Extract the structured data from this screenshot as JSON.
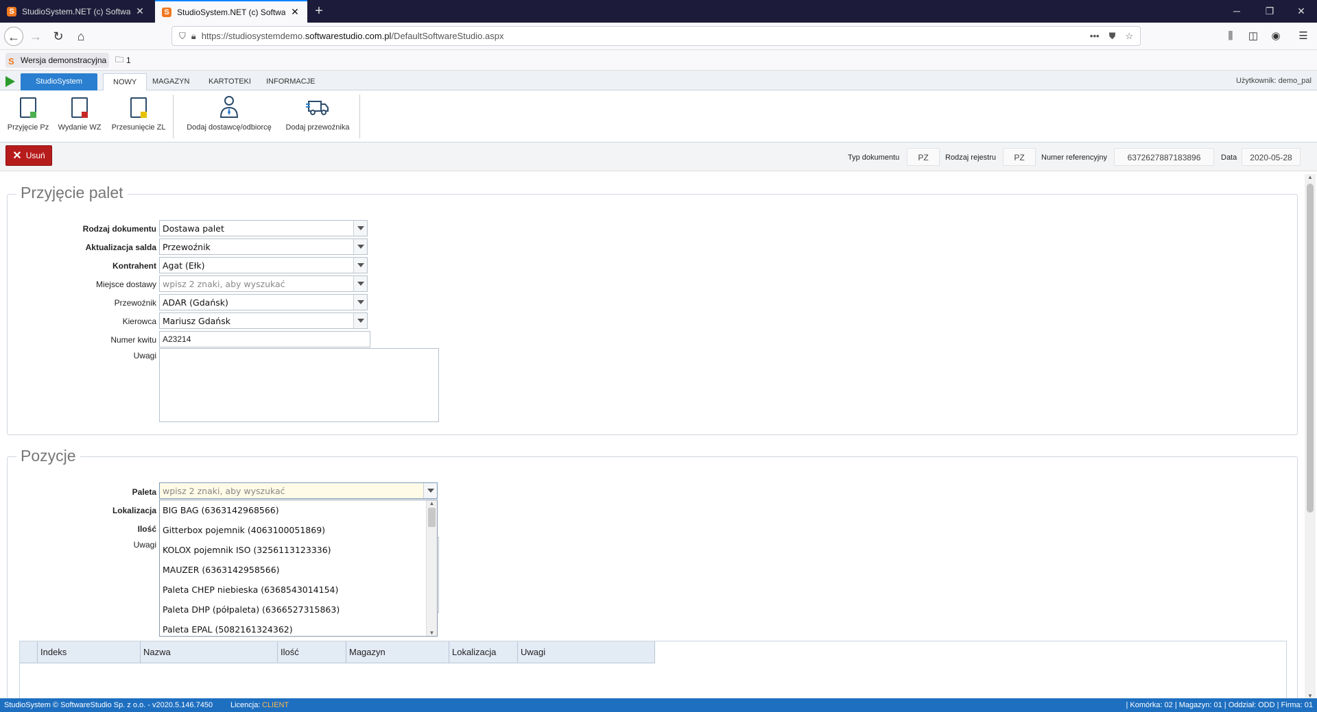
{
  "browser": {
    "tabs": [
      {
        "title": "StudioSystem.NET (c) Software",
        "active": false
      },
      {
        "title": "StudioSystem.NET (c) Software",
        "active": true
      }
    ],
    "url_prefix": "https://studiosystemdemo.",
    "url_domain": "softwarestudio.com.pl",
    "url_path": "/DefaultSoftwareStudio.aspx",
    "bookmarks": [
      {
        "label": "Wersja demonstracyjna"
      },
      {
        "label": "1"
      }
    ]
  },
  "app": {
    "app_tab": "StudioSystem",
    "tabs": [
      "NOWY",
      "MAGAZYN",
      "KARTOTEKI",
      "INFORMACJE"
    ],
    "user_label": "Użytkownik: demo_pal",
    "ribbon": [
      {
        "label": "Przyjęcie Pz"
      },
      {
        "label": "Wydanie WZ"
      },
      {
        "label": "Przesunięcie ZL"
      },
      {
        "label": "Dodaj dostawcę/odbiorcę"
      },
      {
        "label": "Dodaj przewoźnika"
      }
    ]
  },
  "toolbar": {
    "delete_label": "Usuń",
    "doc_type_label": "Typ dokumentu",
    "doc_type_value": "PZ",
    "register_label": "Rodzaj rejestru",
    "register_value": "PZ",
    "ref_label": "Numer referencyjny",
    "ref_value": "6372627887183896",
    "date_label": "Data",
    "date_value": "2020-05-28"
  },
  "header_form": {
    "legend": "Przyjęcie palet",
    "fields": [
      {
        "label": "Rodzaj dokumentu",
        "value": "Dostawa palet"
      },
      {
        "label": "Aktualizacja salda",
        "value": "Przewoźnik"
      },
      {
        "label": "Kontrahent",
        "value": "Agat (Ełk)"
      },
      {
        "label": "Miejsce dostawy",
        "placeholder": "wpisz 2 znaki, aby wyszukać"
      },
      {
        "label": "Przewoźnik",
        "value": "ADAR (Gdańsk)"
      },
      {
        "label": "Kierowca",
        "value": "Mariusz Gdańsk"
      }
    ],
    "receipt_label": "Numer kwitu",
    "receipt_value": "A23214",
    "notes_label": "Uwagi"
  },
  "positions": {
    "legend": "Pozycje",
    "paleta_label": "Paleta",
    "paleta_placeholder": "wpisz 2 znaki, aby wyszukać",
    "lokalizacja_label": "Lokalizacja",
    "ilosc_label": "Ilość",
    "uwagi_label": "Uwagi",
    "dropdown_items": [
      "BIG BAG (6363142968566)",
      "Gitterbox pojemnik (4063100051869)",
      "KOLOX pojemnik ISO (3256113123336)",
      "MAUZER (6363142958566)",
      "Paleta CHEP niebieska (6368543014154)",
      "Paleta DHP (półpaleta) (6366527315863)",
      "Paleta EPAL  (5082161324362)"
    ],
    "columns": [
      "",
      "Indeks",
      "Nazwa",
      "Ilość",
      "Magazyn",
      "Lokalizacja",
      "Uwagi"
    ]
  },
  "status": {
    "copyright": "StudioSystem © SoftwareStudio Sp. z o.o. - v2020.5.146.7450",
    "license_label": "Licencja:",
    "license_value": "CLIENT",
    "right": "| Komórka: 02 | Magazyn: 01 | Oddział: ODD | Firma: 01"
  }
}
